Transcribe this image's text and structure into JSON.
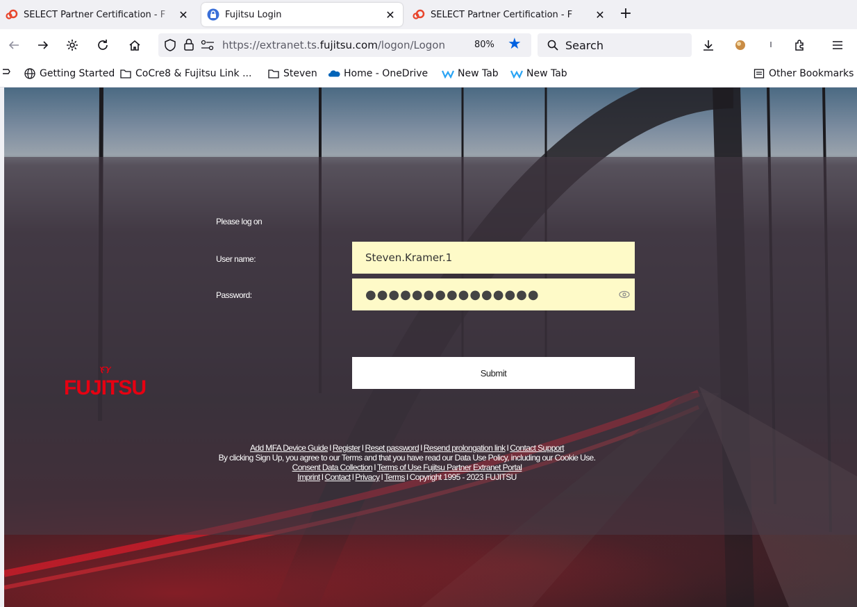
{
  "tabs": [
    {
      "label": "SELECT Partner Certification - F",
      "icon": "select-logo-icon",
      "active": false
    },
    {
      "label": "Fujitsu Login",
      "icon": "lock-icon",
      "active": true
    },
    {
      "label": "SELECT Partner Certification - F",
      "icon": "select-logo-icon",
      "active": false
    }
  ],
  "tab_close_glyph": "✕",
  "newtab_glyph": "+",
  "nav": {
    "url_prefix": "https://extranet.ts.",
    "url_domain": "fujitsu.com",
    "url_suffix": "/logon/Logon",
    "zoom": "80%",
    "search_placeholder": "Search"
  },
  "bookmarks": [
    {
      "label": "Getting Started",
      "icon": "globe-icon"
    },
    {
      "label": "CoCre8 & Fujitsu Link ...",
      "icon": "folder-icon"
    },
    {
      "label": "Steven",
      "icon": "folder-icon"
    },
    {
      "label": "Home - OneDrive",
      "icon": "onedrive-icon"
    },
    {
      "label": "New Tab",
      "icon": "new-tab-icon"
    },
    {
      "label": "New Tab",
      "icon": "new-tab-icon"
    }
  ],
  "other_bookmarks": "Other Bookmarks",
  "login": {
    "heading": "Please log on",
    "username_label": "User name:",
    "username_value": "Steven.Kramer.1",
    "password_label": "Password:",
    "password_mask": "●●●●●●●●●●●●●●●",
    "submit_label": "Submit"
  },
  "logo": {
    "text": "FUJITSU",
    "color": "#e60012"
  },
  "footer": {
    "line1": [
      "Add MFA Device Guide",
      "Register",
      "Reset password",
      "Resend prolongation link",
      "Contact Support"
    ],
    "line2": "By clicking Sign Up, you agree to our Terms and that you have read our Data Use Policy, including our Cookie Use.",
    "line3": [
      "Consent Data Collection",
      "Terms of Use Fujitsu Partner Extranet Portal"
    ],
    "line4_links": [
      "Imprint",
      "Contact",
      "Privacy",
      "Terms"
    ],
    "copyright": "Copyright 1995 - 2023 FUJITSU",
    "separator": "I"
  },
  "colors": {
    "accent_blue": "#0061e0",
    "field_bg": "#fefac8",
    "brand_red": "#e60012"
  }
}
